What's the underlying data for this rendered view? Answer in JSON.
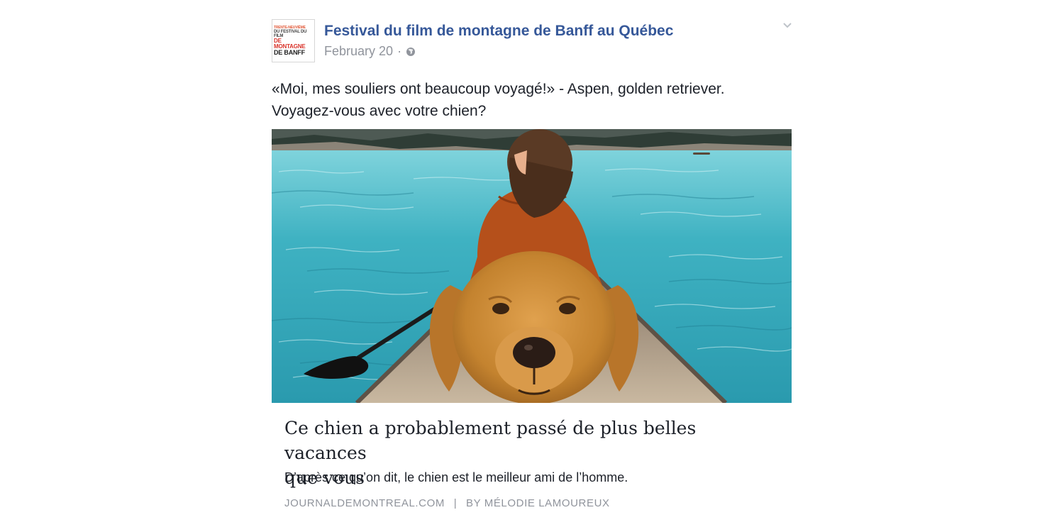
{
  "post": {
    "page_name": "Festival du film de montagne de Banff au Québec",
    "logo_lines": [
      "TRENTE-NEUVIÈME",
      "DU FESTIVAL DU FILM",
      "DE MONTAGNE",
      "DE BANFF"
    ],
    "date": "February 20",
    "separator": "·",
    "caption_line1": "«Moi, mes souliers ont beaucoup voyagé!» - Aspen, golden retriever.",
    "caption_line2": "Voyagez-vous avec votre chien?",
    "icons": {
      "privacy": "globe-icon",
      "menu": "chevron-down-icon"
    }
  },
  "link_preview": {
    "title_line1": "Ce chien a probablement passé de plus belles vacances",
    "title_line2": "que vous",
    "description": "D’après ce qu’on dit, le chien est le meilleur ami de l’homme.",
    "source": "JOURNALDEMONTREAL.COM",
    "source_separator": "|",
    "byline": "BY MÉLODIE LAMOUREUX"
  },
  "colors": {
    "link_blue": "#365899",
    "meta_gray": "#90949c",
    "text": "#1d2129",
    "lake": "#35a9b8",
    "jacket": "#b5501b",
    "dog": "#c98935"
  }
}
